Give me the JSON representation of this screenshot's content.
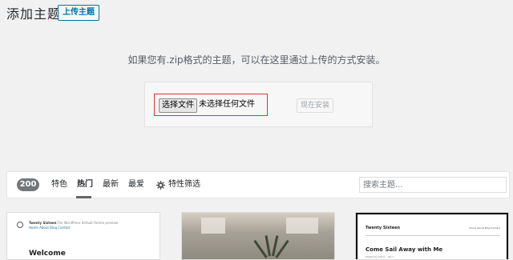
{
  "header": {
    "title": "添加主题",
    "upload_button": "上传主题"
  },
  "upload": {
    "instructions": "如果您有.zip格式的主题，可以在这里通过上传的方式安装。",
    "choose_file_label": "选择文件",
    "no_file_text": "未选择任何文件",
    "install_button": "现在安装",
    "highlight_color": "#d63638"
  },
  "filters": {
    "count": "200",
    "tabs": [
      {
        "label": "特色",
        "current": false
      },
      {
        "label": "热门",
        "current": true
      },
      {
        "label": "最新",
        "current": false
      },
      {
        "label": "最爱",
        "current": false
      }
    ],
    "feature_filter": {
      "label": "特性筛选",
      "icon": "gear-icon"
    },
    "search_placeholder": "搜索主题..."
  },
  "themes": [
    {
      "preview": {
        "site_title": "Twenty Sixteen",
        "tagline": "The WordPress default theme preview",
        "nav": "Home  About  Blog  Contact",
        "heading": "Welcome"
      }
    },
    {
      "preview": {}
    },
    {
      "preview": {
        "site_title": "Twenty Sixteen",
        "nav": "Home  About  Blog  Contact",
        "heading": "Come Sail Away with Me",
        "meta": "Posted by admin  ·  Jan 1"
      }
    }
  ]
}
